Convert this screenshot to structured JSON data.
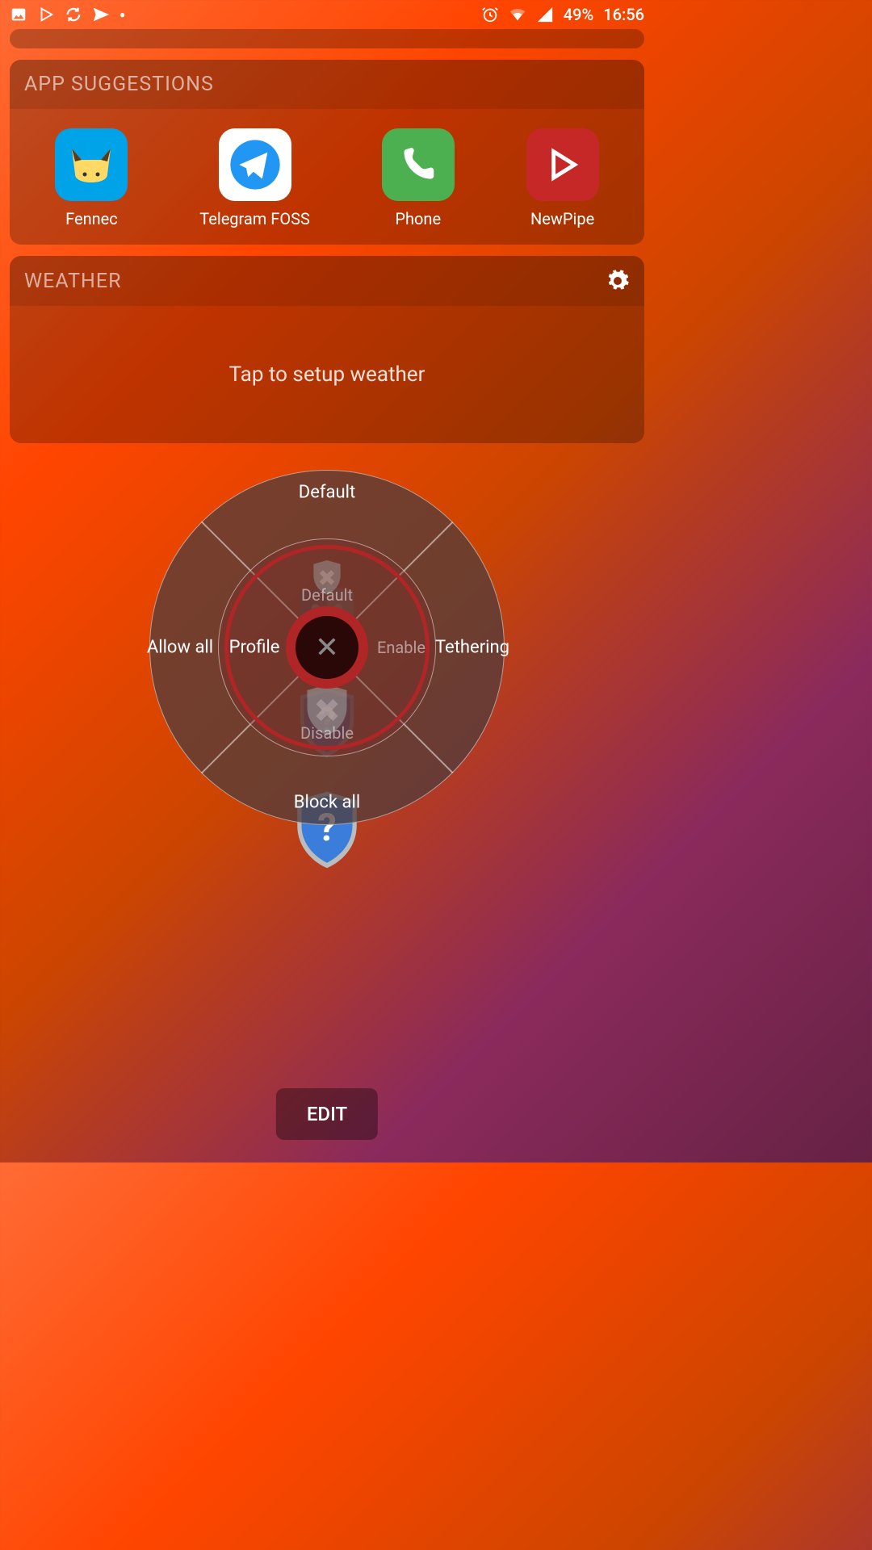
{
  "status_bar": {
    "battery_text": "49%",
    "time": "16:56"
  },
  "cards": {
    "suggestions": {
      "title": "APP SUGGESTIONS",
      "apps": [
        {
          "label": "Fennec"
        },
        {
          "label": "Telegram FOSS"
        },
        {
          "label": "Phone"
        },
        {
          "label": "NewPipe"
        }
      ]
    },
    "weather": {
      "title": "WEATHER",
      "body": "Tap to setup weather"
    }
  },
  "radial_menu": {
    "outer": {
      "top": "Default",
      "right": "Tethering",
      "bottom": "Block all",
      "left": "Allow all"
    },
    "inner": {
      "top": "Default",
      "right": "Enable",
      "bottom": "Disable",
      "left": "Profile"
    },
    "center_icon": "close-x"
  },
  "edit_button": "EDIT"
}
